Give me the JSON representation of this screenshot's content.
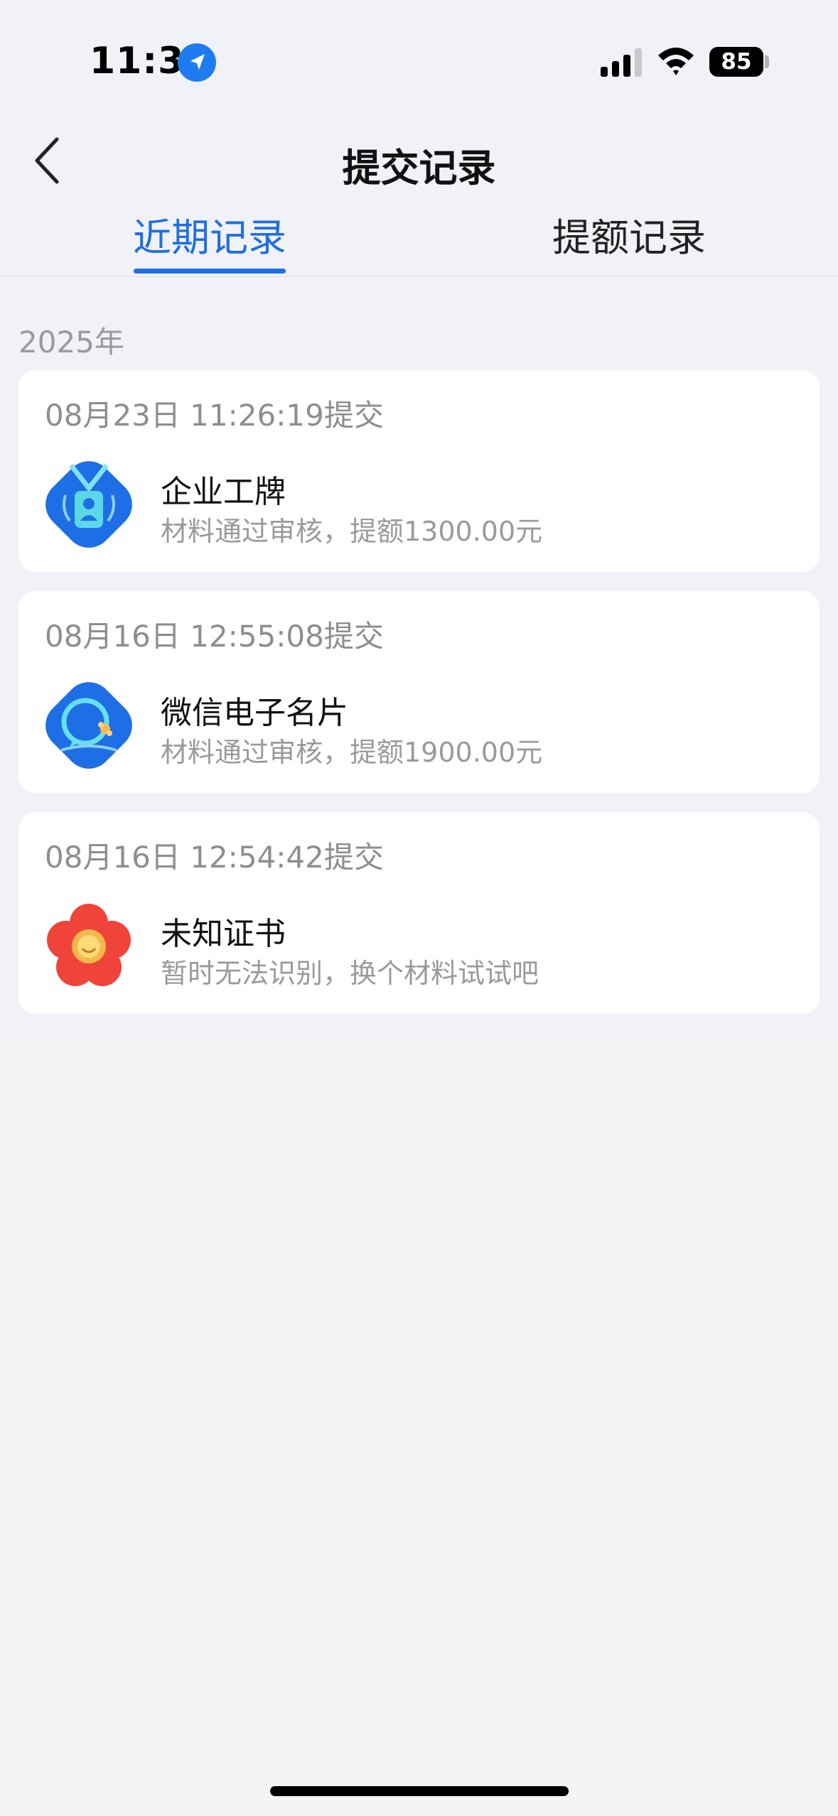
{
  "status_bar": {
    "time": "11:31",
    "battery": "85"
  },
  "header": {
    "title": "提交记录",
    "tabs": [
      {
        "label": "近期记录",
        "active": true
      },
      {
        "label": "提额记录",
        "active": false
      }
    ]
  },
  "year": "2025年",
  "records": [
    {
      "time": "08月23日 11:26:19提交",
      "title": "企业工牌",
      "subtitle": "材料通过审核，提额1300.00元",
      "icon": "badge-icon"
    },
    {
      "time": "08月16日 12:55:08提交",
      "title": "微信电子名片",
      "subtitle": "材料通过审核，提额1900.00元",
      "icon": "wechat-card-icon"
    },
    {
      "time": "08月16日 12:54:42提交",
      "title": "未知证书",
      "subtitle": "暂时无法识别，换个材料试试吧",
      "icon": "flower-icon"
    }
  ],
  "colors": {
    "accent": "#1f6fe0",
    "page_bg": "#f0f2f7"
  }
}
